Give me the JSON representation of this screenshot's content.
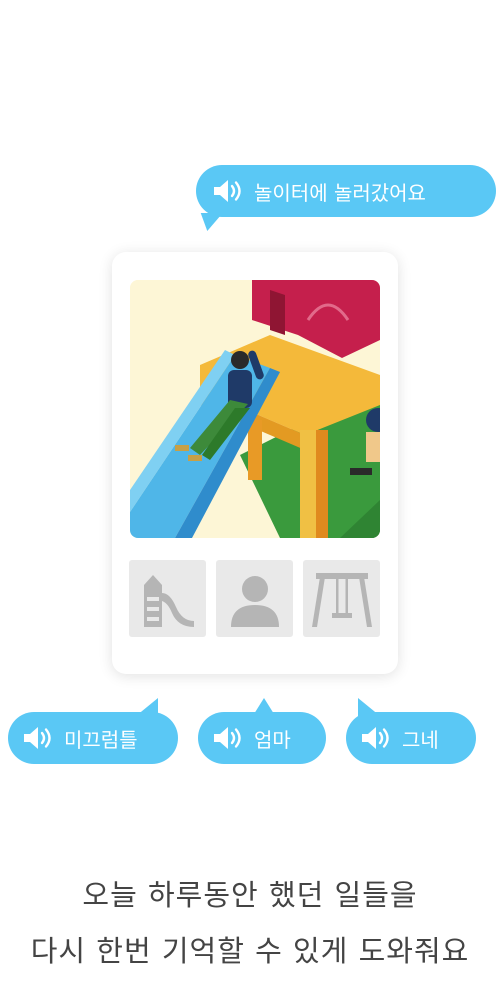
{
  "bubbles": {
    "top": "놀이터에 놀러갔어요",
    "slide": "미끄럼틀",
    "mom": "엄마",
    "swing": "그네"
  },
  "caption": {
    "line1": "오늘 하루동안 했던 일들을",
    "line2": "다시 한번 기억할 수 있게 도와줘요"
  },
  "icons": [
    "speaker-icon",
    "slide-icon",
    "person-icon",
    "swing-icon"
  ],
  "colors": {
    "bubble": "#5ac8f5",
    "tile": "#e9e9e9",
    "tile_icon": "#b5b5b5",
    "caption": "#444444"
  }
}
